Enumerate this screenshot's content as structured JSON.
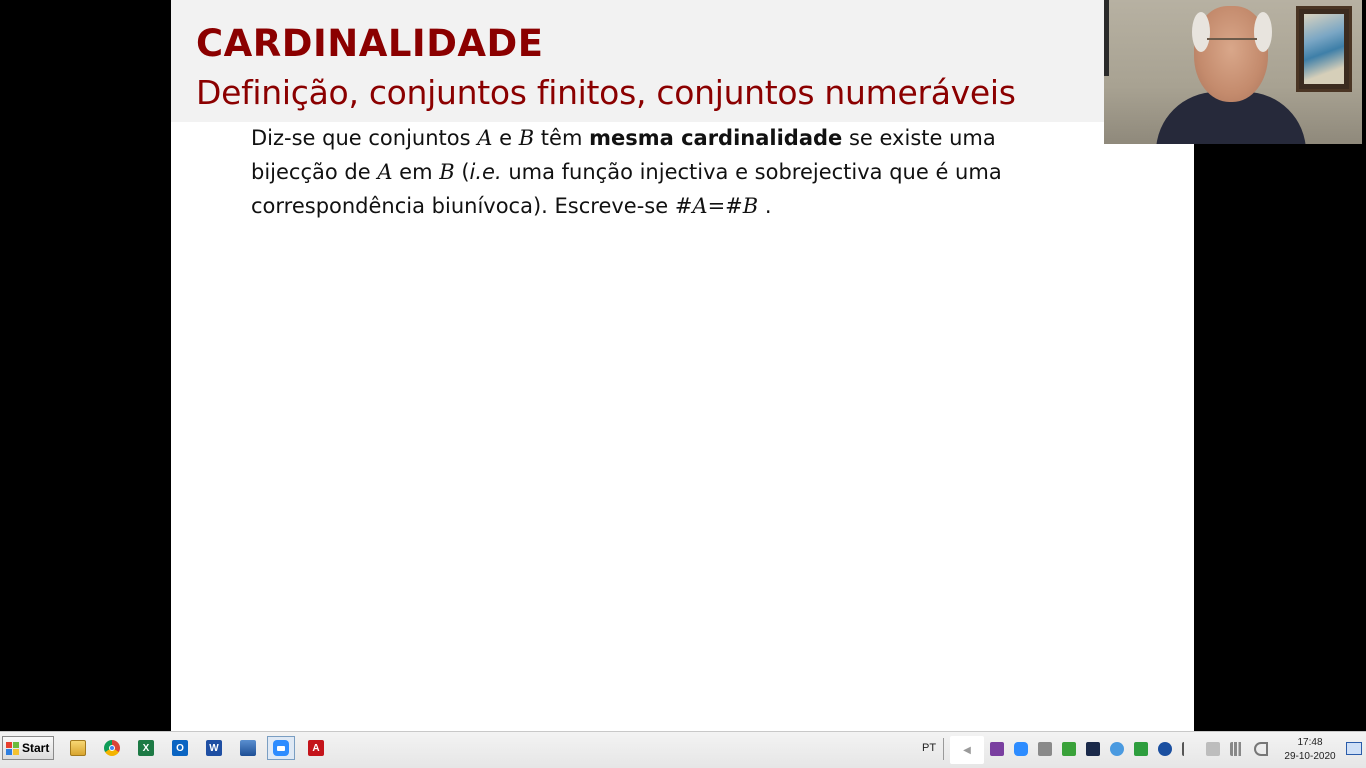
{
  "slide": {
    "title": "CARDINALIDADE",
    "subtitle": "Definição, conjuntos finitos, conjuntos numeráveis",
    "body": {
      "l1_a": "Diz-se que conjuntos ",
      "var_A": "A",
      "l1_b": " e ",
      "var_B": "B",
      "l1_c": " têm ",
      "bold_term": "mesma cardinalidade",
      "l1_d": " se existe uma",
      "l2_a": "bijecção de ",
      "l2_b": " em ",
      "l2_c": " (",
      "ie": "i.e.",
      "l2_d": " uma função injectiva e sobrejectiva que é uma",
      "l3_a": "correspondência biunívoca).  Escreve-se ",
      "formula": "#A=#B",
      "l3_end": " ."
    },
    "colors": {
      "title": "#8b0000",
      "header_bg": "#f2f2f2"
    }
  },
  "webcam": {
    "description_icon": "webcam-video-icon"
  },
  "taskbar": {
    "start_label": "Start",
    "apps": [
      {
        "name": "file-explorer",
        "icon": "folder-icon"
      },
      {
        "name": "chrome",
        "icon": "chrome-icon"
      },
      {
        "name": "excel",
        "icon": "excel-icon",
        "glyph": "X"
      },
      {
        "name": "outlook",
        "icon": "outlook-icon",
        "glyph": "O"
      },
      {
        "name": "word",
        "icon": "word-icon",
        "glyph": "W"
      },
      {
        "name": "network-drive",
        "icon": "network-icon"
      },
      {
        "name": "zoom",
        "icon": "zoom-icon"
      },
      {
        "name": "acrobat",
        "icon": "acrobat-icon",
        "glyph": "A"
      }
    ],
    "language": "PT",
    "clock": {
      "time": "17:48",
      "date": "29-10-2020"
    }
  }
}
